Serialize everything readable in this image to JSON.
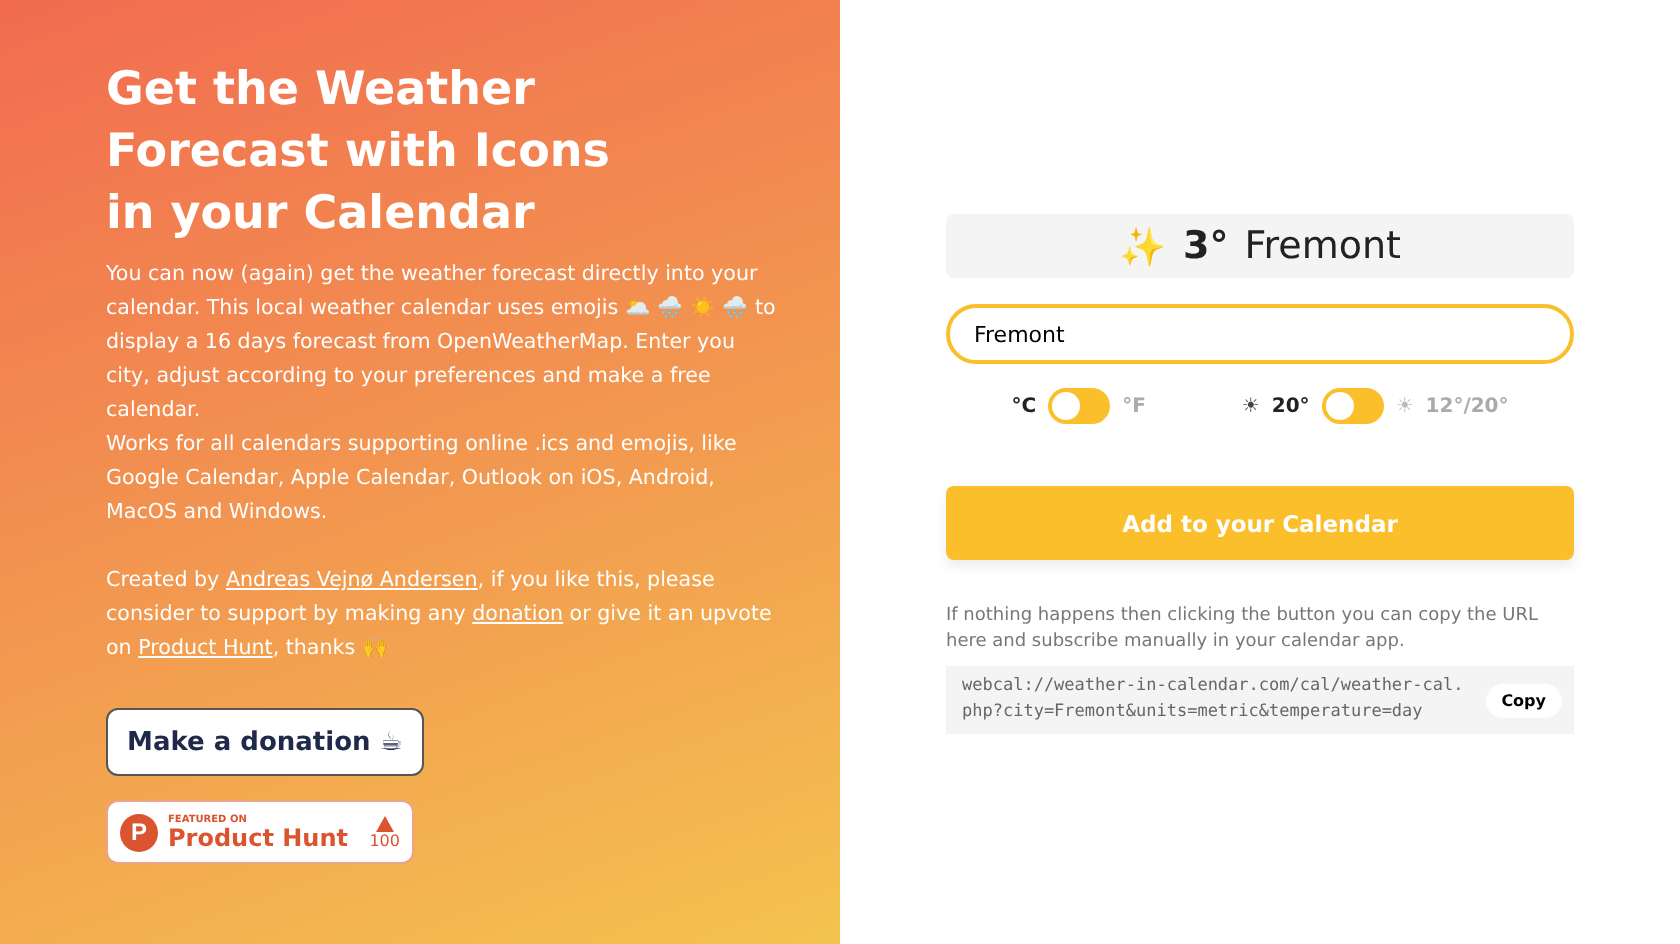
{
  "hero": {
    "title": "Get the Weather Forecast with Icons in your Calendar",
    "paragraphs": [
      [
        {
          "text": "You can now (again) get the weather forecast directly into your calendar. This local weather calendar uses emojis 🌥️ 🌧️ ☀️ 🌧️  to display a 16 days forecast from OpenWeatherMap. Enter you city, adjust according to your preferences and make a free calendar."
        }
      ],
      [
        {
          "text": "Works for all calendars supporting online .ics and emojis, like Google Calendar, Apple Calendar, Outlook on iOS, Android, MacOS and Windows."
        }
      ],
      [
        {
          "text": "Created by "
        },
        {
          "text": "Andreas Vejnø Andersen",
          "link": true
        },
        {
          "text": ", if you like this, please consider to support by making any "
        },
        {
          "text": "donation",
          "link": true
        },
        {
          "text": " or give it an upvote on "
        },
        {
          "text": "Product Hunt",
          "link": true
        },
        {
          "text": ", thanks 🙌"
        }
      ]
    ],
    "donate_button": "Make a donation ☕",
    "badge": {
      "logo_letter": "P",
      "caption": "FEATURED ON",
      "name": "Product Hunt",
      "count": "100"
    }
  },
  "preview": {
    "icon": "✨",
    "temperature": "3°",
    "city": "Fremont"
  },
  "city_field": {
    "value": "Fremont"
  },
  "toggles": [
    {
      "left_label": "°C",
      "right_label": "°F",
      "on": false
    },
    {
      "left_icon": "☀",
      "left_label": "20°",
      "right_icon": "☀",
      "right_label": "12°/20°",
      "on": false
    }
  ],
  "add_button": "Add to your Calendar",
  "help_text": "If nothing happens then clicking the button you can copy the URL here and subscribe manually in your calendar app.",
  "url": {
    "text": "webcal://weather-in-calendar.com/cal/weather-cal.php?city=Fremont&units=metric&temperature=day",
    "copy_button": "Copy"
  }
}
